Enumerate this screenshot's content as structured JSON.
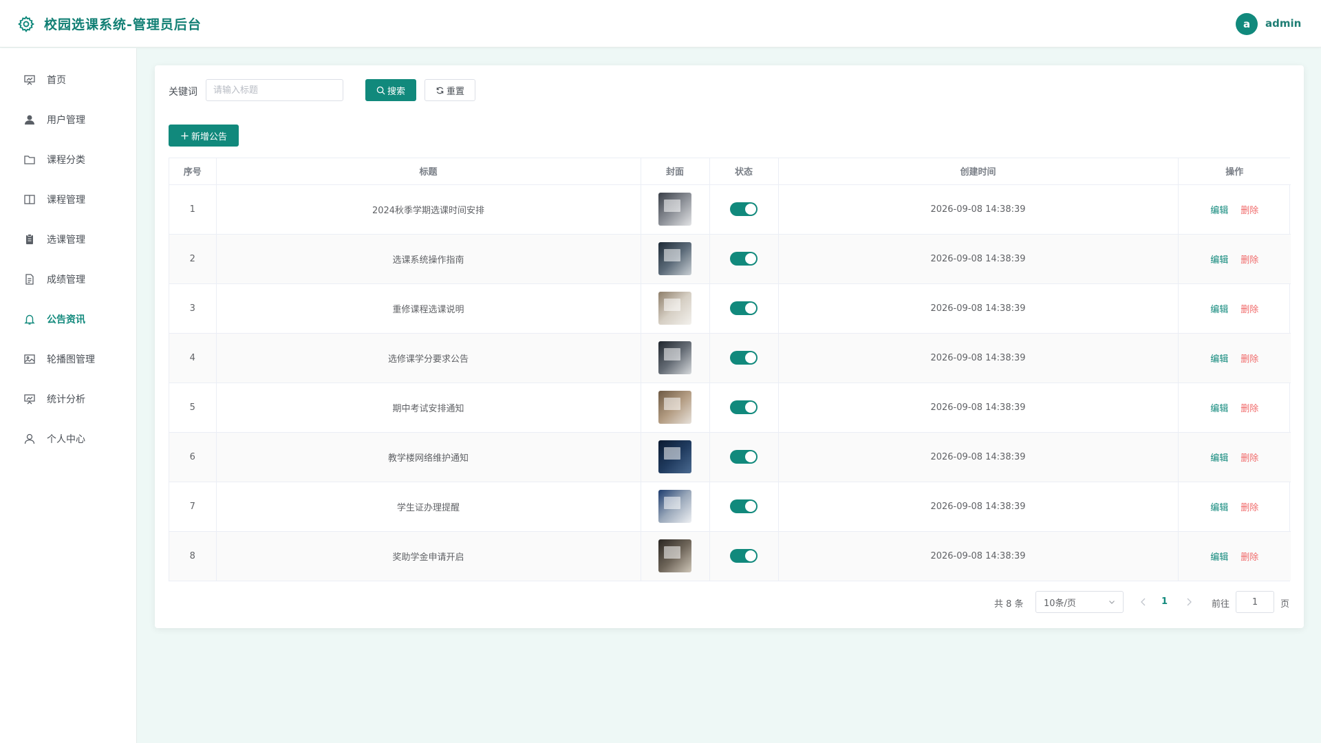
{
  "app": {
    "title": "校园选课系统-管理员后台"
  },
  "user": {
    "avatar_letter": "a",
    "name": "admin"
  },
  "colors": {
    "primary": "#11897c",
    "danger": "#f06a6a",
    "background": "#eef8f6"
  },
  "sidebar": {
    "active_index": 6,
    "items": [
      {
        "label": "首页",
        "icon": "chart-board-icon"
      },
      {
        "label": "用户管理",
        "icon": "user-filled-icon"
      },
      {
        "label": "课程分类",
        "icon": "folder-icon"
      },
      {
        "label": "课程管理",
        "icon": "book-open-icon"
      },
      {
        "label": "选课管理",
        "icon": "clipboard-icon"
      },
      {
        "label": "成绩管理",
        "icon": "document-icon"
      },
      {
        "label": "公告资讯",
        "icon": "bell-icon"
      },
      {
        "label": "轮播图管理",
        "icon": "picture-icon"
      },
      {
        "label": "统计分析",
        "icon": "chart-board-icon"
      },
      {
        "label": "个人中心",
        "icon": "user-icon"
      }
    ]
  },
  "search": {
    "label": "关键词",
    "placeholder": "请输入标题",
    "value": "",
    "search_button": "搜索",
    "reset_button": "重置"
  },
  "toolbar": {
    "add_button": "新增公告"
  },
  "table": {
    "columns": [
      "序号",
      "标题",
      "封面",
      "状态",
      "创建时间",
      "操作"
    ],
    "edit_label": "编辑",
    "delete_label": "删除",
    "rows": [
      {
        "index": "1",
        "title": "2024秋季学期选课时间安排",
        "status": true,
        "created": "2026-09-08 14:38:39"
      },
      {
        "index": "2",
        "title": "选课系统操作指南",
        "status": true,
        "created": "2026-09-08 14:38:39"
      },
      {
        "index": "3",
        "title": "重修课程选课说明",
        "status": true,
        "created": "2026-09-08 14:38:39"
      },
      {
        "index": "4",
        "title": "选修课学分要求公告",
        "status": true,
        "created": "2026-09-08 14:38:39"
      },
      {
        "index": "5",
        "title": "期中考试安排通知",
        "status": true,
        "created": "2026-09-08 14:38:39"
      },
      {
        "index": "6",
        "title": "教学楼网络维护通知",
        "status": true,
        "created": "2026-09-08 14:38:39"
      },
      {
        "index": "7",
        "title": "学生证办理提醒",
        "status": true,
        "created": "2026-09-08 14:38:39"
      },
      {
        "index": "8",
        "title": "奖助学金申请开启",
        "status": true,
        "created": "2026-09-08 14:38:39"
      }
    ]
  },
  "pagination": {
    "total": "共 8 条",
    "page_size": "10条/页",
    "current_page": "1",
    "goto_label": "前往",
    "goto_value": "1",
    "page_suffix": "页"
  }
}
